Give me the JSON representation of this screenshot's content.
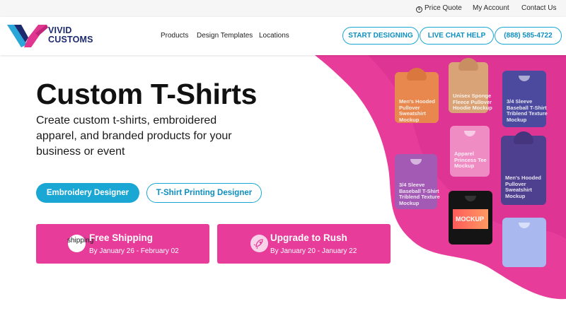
{
  "topbar": {
    "price_quote": "Price Quote",
    "my_account": "My Account",
    "contact_us": "Contact Us"
  },
  "brand": {
    "line1": "VIVID",
    "line2": "CUSTOMS",
    "colors": {
      "navy": "#1e2a6e",
      "blue": "#2aa7d8",
      "magenta": "#e0368f"
    }
  },
  "nav": {
    "items": [
      "Products",
      "Design Templates",
      "Locations"
    ],
    "start_designing": "START DESIGNING",
    "live_chat": "LIVE CHAT HELP",
    "phone": "(888) 585-4722"
  },
  "hero": {
    "title": "Custom T-Shirts",
    "subtitle": "Create custom t-shirts, embroidered apparel, and branded products for your business or event",
    "buttons": {
      "embroidery": "Embroidery Designer",
      "tshirt": "T-Shirt Printing Designer"
    },
    "accent_color": "#e73c9a"
  },
  "cards": {
    "shipping": {
      "icon_alt": "shipping",
      "title": "Free Shipping",
      "subtitle": "By January 26 - February 02"
    },
    "rush": {
      "icon": "rocket-icon",
      "title": "Upgrade to Rush",
      "subtitle": "By January 20 - January 22"
    }
  },
  "mockups": [
    {
      "name": "orange-hoodie",
      "text": "Men's Hooded\nPullover\nSweatshirt\nMockup"
    },
    {
      "name": "tan-hoodie",
      "text": "Unisex Sponge\nFleece Pullover\nHoodie Mockup"
    },
    {
      "name": "navy-raglan",
      "text": "3/4 Sleeve\nBaseball T-Shirt\nTriblend Texture\nMockup"
    },
    {
      "name": "pink-tee",
      "text": "Apparel\nPrincess Tee\nMockup"
    },
    {
      "name": "raglan-pink",
      "text": "3/4 Sleeve\nBaseball T-Shirt\nTriblend Texture\nMockup"
    },
    {
      "name": "black-tee",
      "text": "MOCKUP"
    },
    {
      "name": "purple-hoodie",
      "text": "Men's Hooded\nPullover\nSweatshirt\nMockup"
    },
    {
      "name": "light-blue-tee",
      "text": ""
    }
  ]
}
